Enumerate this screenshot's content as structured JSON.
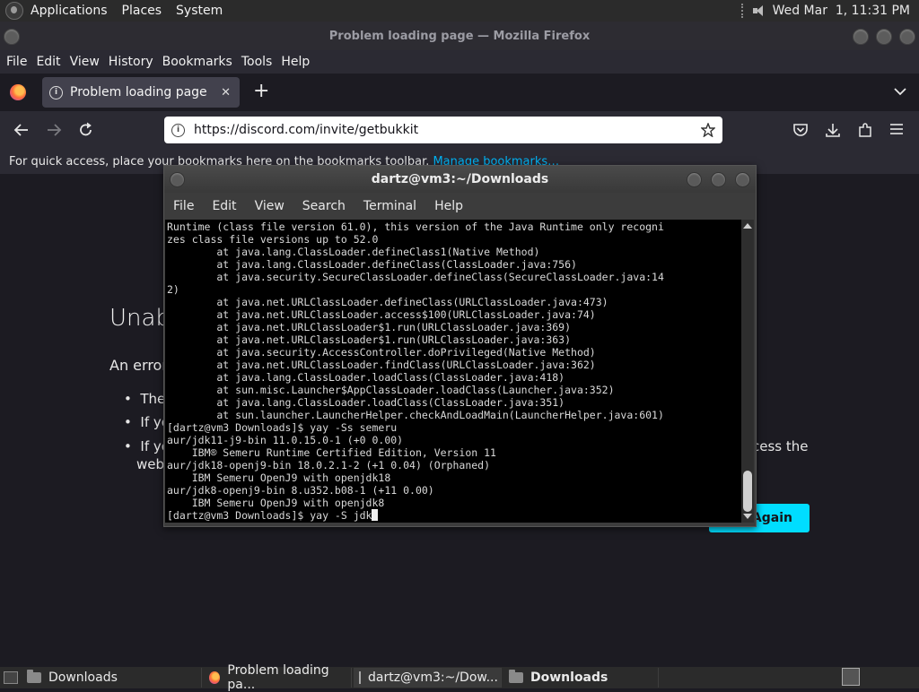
{
  "top_panel": {
    "menus": [
      "Applications",
      "Places",
      "System"
    ],
    "clock": "Wed Mar  1, 11:31 PM"
  },
  "firefox": {
    "window_title": "Problem loading page — Mozilla Firefox",
    "menubar": {
      "file": "File",
      "edit": "Edit",
      "view": "View",
      "history": "History",
      "bookmarks": "Bookmarks",
      "tools": "Tools",
      "help": "Help"
    },
    "tab": {
      "title": "Problem loading page",
      "close": "✕",
      "new_tab": "+"
    },
    "url": "https://discord.com/invite/getbukkit",
    "bookmarks_bar": {
      "text": "For quick access, place your bookmarks here on the bookmarks toolbar.",
      "link": "Manage bookmarks…"
    },
    "error_page": {
      "title_partial": "Unab",
      "line1": "An error",
      "bullet1": "The s",
      "bullet2": "If you",
      "bullet3_start": "If you",
      "bullet3_end": "cess the",
      "bullet3_line2": "web",
      "try_again": "Try Again"
    }
  },
  "terminal": {
    "title": "dartz@vm3:~/Downloads",
    "menu": [
      "File",
      "Edit",
      "View",
      "Search",
      "Terminal",
      "Help"
    ],
    "lines": [
      "Runtime (class file version 61.0), this version of the Java Runtime only recogni",
      "zes class file versions up to 52.0",
      "        at java.lang.ClassLoader.defineClass1(Native Method)",
      "        at java.lang.ClassLoader.defineClass(ClassLoader.java:756)",
      "        at java.security.SecureClassLoader.defineClass(SecureClassLoader.java:14",
      "2)",
      "        at java.net.URLClassLoader.defineClass(URLClassLoader.java:473)",
      "        at java.net.URLClassLoader.access$100(URLClassLoader.java:74)",
      "        at java.net.URLClassLoader$1.run(URLClassLoader.java:369)",
      "        at java.net.URLClassLoader$1.run(URLClassLoader.java:363)",
      "        at java.security.AccessController.doPrivileged(Native Method)",
      "        at java.net.URLClassLoader.findClass(URLClassLoader.java:362)",
      "        at java.lang.ClassLoader.loadClass(ClassLoader.java:418)",
      "        at sun.misc.Launcher$AppClassLoader.loadClass(Launcher.java:352)",
      "        at java.lang.ClassLoader.loadClass(ClassLoader.java:351)",
      "        at sun.launcher.LauncherHelper.checkAndLoadMain(LauncherHelper.java:601)",
      "[dartz@vm3 Downloads]$ yay -Ss semeru",
      "aur/jdk11-j9-bin 11.0.15.0-1 (+0 0.00)",
      "    IBM® Semeru Runtime Certified Edition, Version 11",
      "aur/jdk18-openj9-bin 18.0.2.1-2 (+1 0.04) (Orphaned)",
      "    IBM Semeru OpenJ9 with openjdk18",
      "aur/jdk8-openj9-bin 8.u352.b08-1 (+11 0.00)",
      "    IBM Semeru OpenJ9 with openjdk8"
    ],
    "prompt_line": "[dartz@vm3 Downloads]$ yay -S jdk"
  },
  "taskbar": {
    "items": [
      "Downloads",
      "Problem loading pa...",
      "dartz@vm3:~/Dow...",
      "Downloads"
    ]
  },
  "colors": {
    "firefox_dark": "#1c1b22",
    "accent_cyan": "#00ddff",
    "link_blue": "#00b3f4"
  }
}
